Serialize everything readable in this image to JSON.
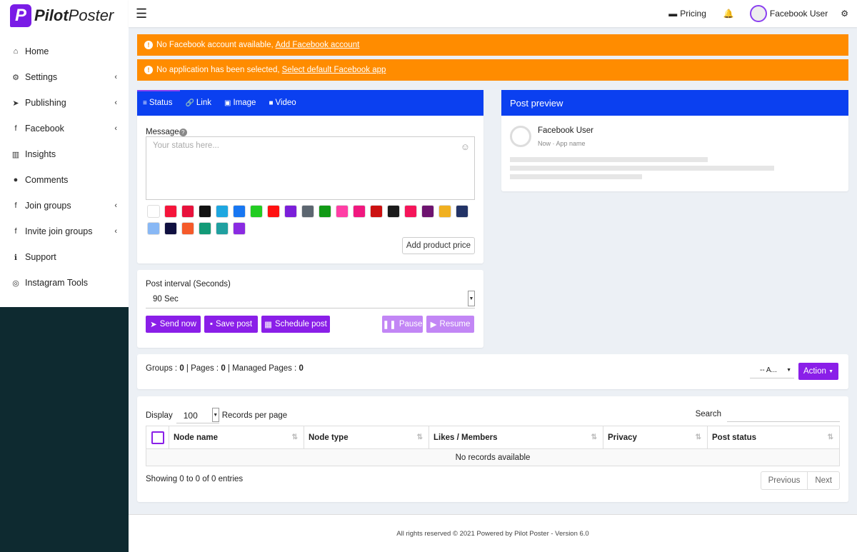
{
  "brand": {
    "logo_letter": "P",
    "name_bold": "Pilot",
    "name_rest": "Poster"
  },
  "sidebar": {
    "items": [
      {
        "icon": "⌂",
        "label": "Home",
        "chevron": ""
      },
      {
        "icon": "⚙",
        "label": "Settings",
        "chevron": "‹"
      },
      {
        "icon": "➤",
        "label": "Publishing",
        "chevron": "‹"
      },
      {
        "icon": "f",
        "label": "Facebook",
        "chevron": "‹"
      },
      {
        "icon": "▥",
        "label": "Insights",
        "chevron": ""
      },
      {
        "icon": "●",
        "label": "Comments",
        "chevron": ""
      },
      {
        "icon": "f",
        "label": "Join groups",
        "chevron": "‹"
      },
      {
        "icon": "f",
        "label": "Invite join groups",
        "chevron": "‹"
      },
      {
        "icon": "ℹ",
        "label": "Support",
        "chevron": ""
      },
      {
        "icon": "◎",
        "label": "Instagram Tools",
        "chevron": ""
      }
    ]
  },
  "header": {
    "pricing_label": "Pricing",
    "user_name": "Facebook User"
  },
  "alerts": {
    "no_account": {
      "text": "No Facebook account available,",
      "link": "Add Facebook account"
    },
    "no_app": {
      "text": "No application has been selected,",
      "link": "Select default Facebook app"
    }
  },
  "composer": {
    "tabs": [
      {
        "icon": "≡",
        "label": "Status"
      },
      {
        "icon": "🔗",
        "label": "Link"
      },
      {
        "icon": "▣",
        "label": "Image"
      },
      {
        "icon": "■",
        "label": "Video"
      }
    ],
    "message_label": "Message",
    "message_placeholder": "Your status here...",
    "add_product_price": "Add product price",
    "swatches": [
      "#ffffff",
      "#f5153b",
      "#e8123c",
      "#111111",
      "#1ea7e0",
      "#1877f2",
      "#22cc22",
      "#ff1111",
      "#7b1fd9",
      "#5c6670",
      "#129a16",
      "#ff3ea5",
      "#f0187f",
      "#cc1111",
      "#1a1a1a",
      "#f5155a",
      "#6e1470",
      "#f0b020",
      "#223366",
      "#88b8f5",
      "#101040",
      "#f55a2a",
      "#139a77",
      "#20a0a0",
      "#8a2be2"
    ]
  },
  "interval": {
    "label": "Post interval (Seconds)",
    "value": "90 Sec",
    "buttons": {
      "send_now": "Send now",
      "save_post": "Save post",
      "schedule_post": "Schedule post",
      "pause": "Pause",
      "resume": "Resume"
    }
  },
  "preview": {
    "title": "Post preview",
    "user": "Facebook User",
    "meta": "Now · App name"
  },
  "counts": {
    "groups_label": "Groups :",
    "groups": "0",
    "pages_label": "| Pages :",
    "pages": "0",
    "managed_label": "| Managed Pages :",
    "managed": "0",
    "filter_value": "-- A...",
    "action_label": "Action"
  },
  "table": {
    "display_label": "Display",
    "per_page": "100",
    "records_label": "Records per page",
    "search_label": "Search",
    "columns": [
      "Node name",
      "Node type",
      "Likes / Members",
      "Privacy",
      "Post status"
    ],
    "empty": "No records available",
    "info": "Showing 0 to 0 of 0 entries",
    "prev": "Previous",
    "next": "Next"
  },
  "footer": "All rights reserved © 2021 Powered by Pilot Poster - Version 6.0"
}
